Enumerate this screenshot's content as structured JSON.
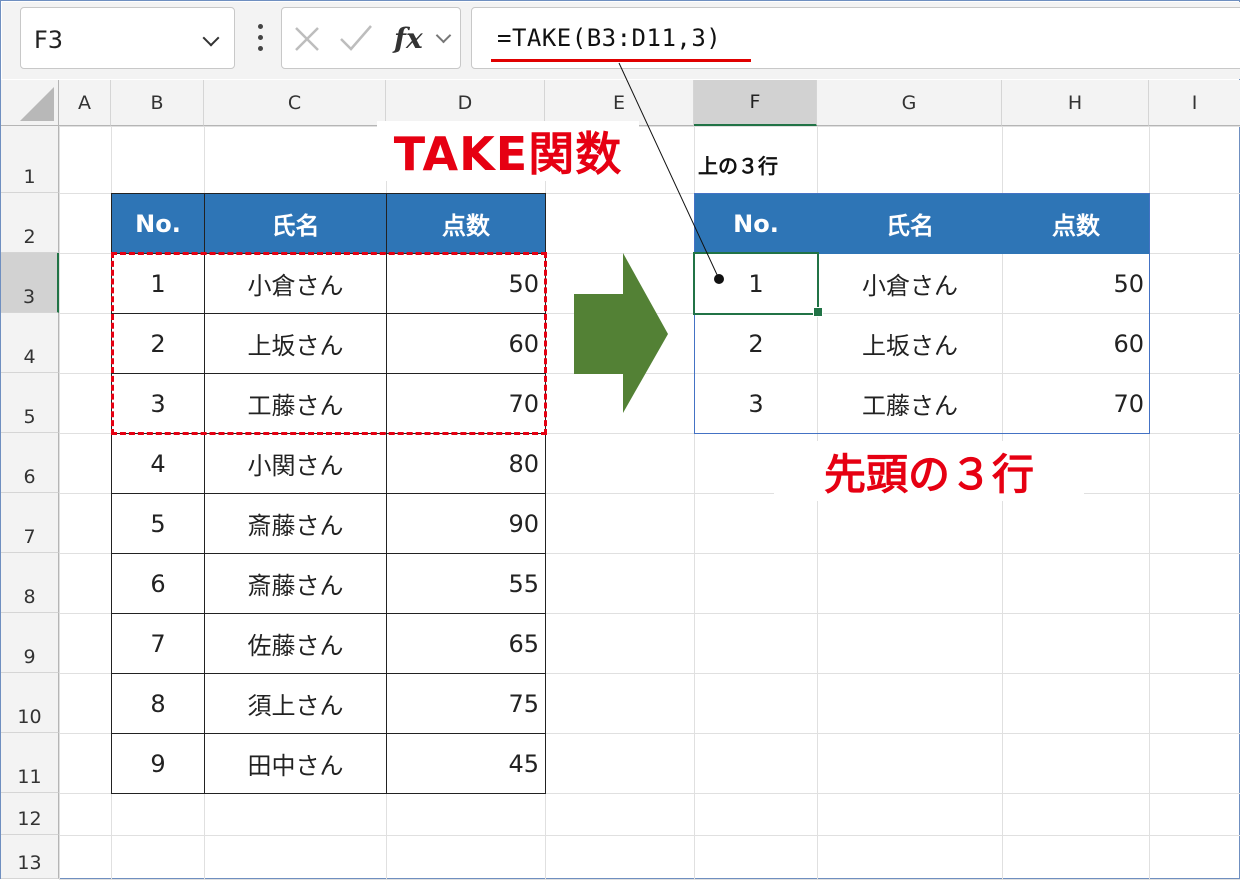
{
  "formula_bar": {
    "name_box": "F3",
    "fx_label": "fx",
    "formula": "=TAKE(B3:D11,3)"
  },
  "columns": [
    "A",
    "B",
    "C",
    "D",
    "E",
    "F",
    "G",
    "H",
    "I"
  ],
  "selected_column": "F",
  "rows": [
    "1",
    "2",
    "3",
    "4",
    "5",
    "6",
    "7",
    "8",
    "9",
    "10",
    "11",
    "12",
    "13"
  ],
  "selected_row": "3",
  "source_table": {
    "headers": [
      "No.",
      "氏名",
      "点数"
    ],
    "rows": [
      [
        "1",
        "小倉さん",
        "50"
      ],
      [
        "2",
        "上坂さん",
        "60"
      ],
      [
        "3",
        "工藤さん",
        "70"
      ],
      [
        "4",
        "小関さん",
        "80"
      ],
      [
        "5",
        "斎藤さん",
        "90"
      ],
      [
        "6",
        "斎藤さん",
        "55"
      ],
      [
        "7",
        "佐藤さん",
        "65"
      ],
      [
        "8",
        "須上さん",
        "75"
      ],
      [
        "9",
        "田中さん",
        "45"
      ]
    ]
  },
  "result_label": "上の３行",
  "result_table": {
    "headers": [
      "No.",
      "氏名",
      "点数"
    ],
    "rows": [
      [
        "1",
        "小倉さん",
        "50"
      ],
      [
        "2",
        "上坂さん",
        "60"
      ],
      [
        "3",
        "工藤さん",
        "70"
      ]
    ]
  },
  "annotations": {
    "title": "TAKE関数",
    "caption": "先頭の３行"
  },
  "colors": {
    "header_fill": "#2e75b6",
    "annotation_red": "#e60012",
    "arrow_green": "#538135",
    "selection_green": "#217346"
  }
}
